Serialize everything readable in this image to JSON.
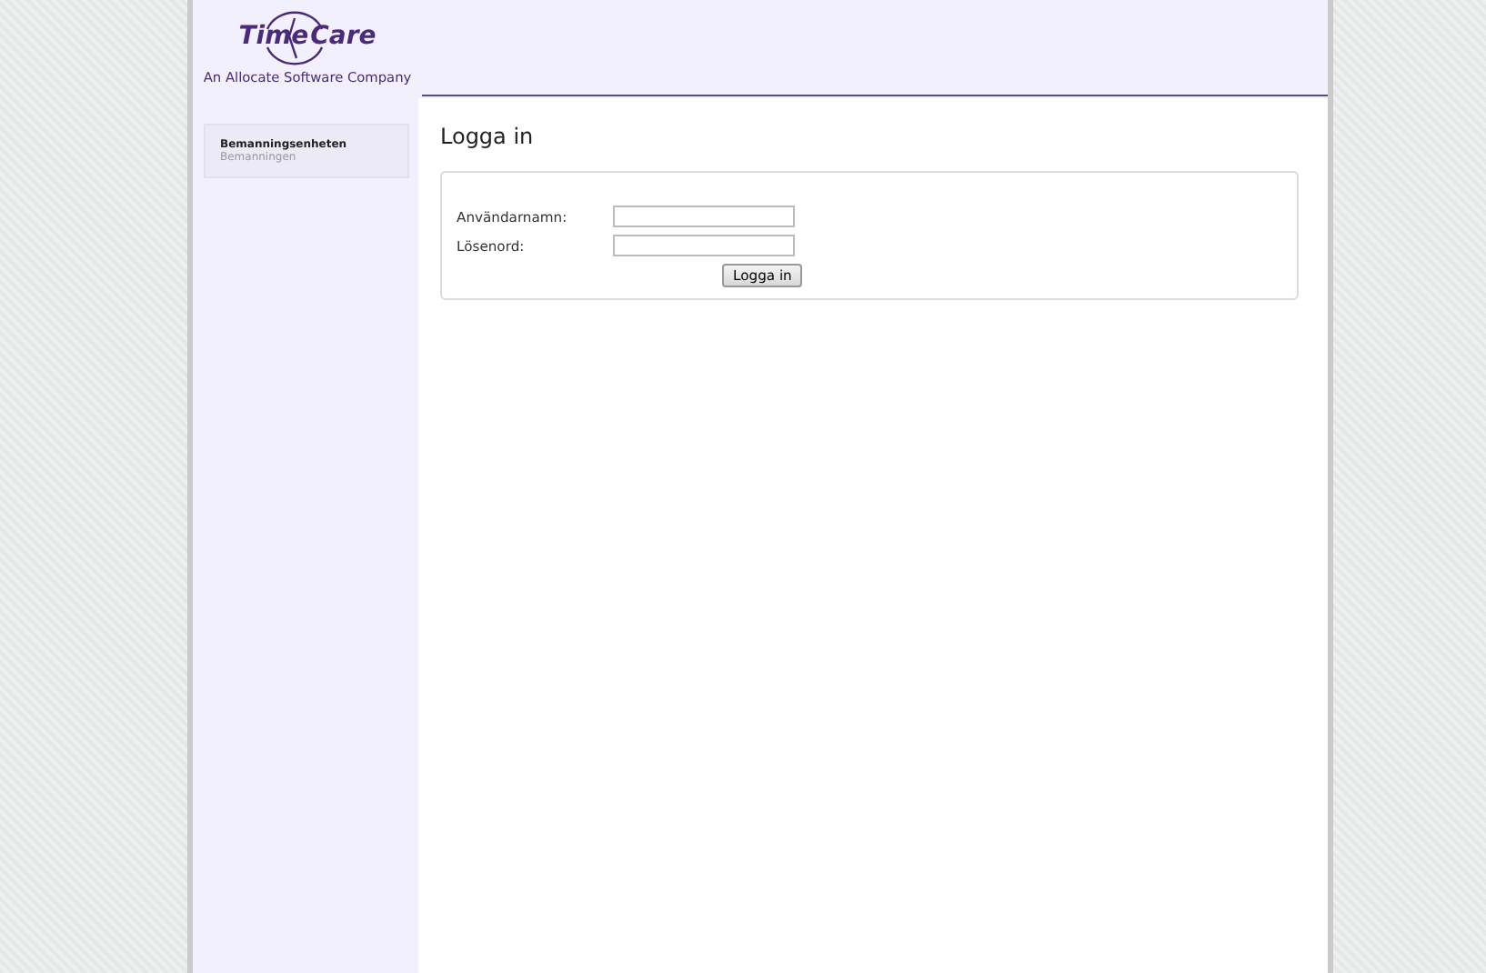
{
  "logo": {
    "words": [
      "Time",
      "Care"
    ],
    "tagline": "An Allocate Software Company"
  },
  "sidebar": {
    "items": [
      {
        "title": "Bemanningsenheten",
        "subtitle": "Bemanningen"
      }
    ]
  },
  "page": {
    "title": "Logga in"
  },
  "login_form": {
    "fields": [
      {
        "label": "Användarnamn:"
      },
      {
        "label": "Lösenord:"
      }
    ],
    "button": "Logga in"
  }
}
